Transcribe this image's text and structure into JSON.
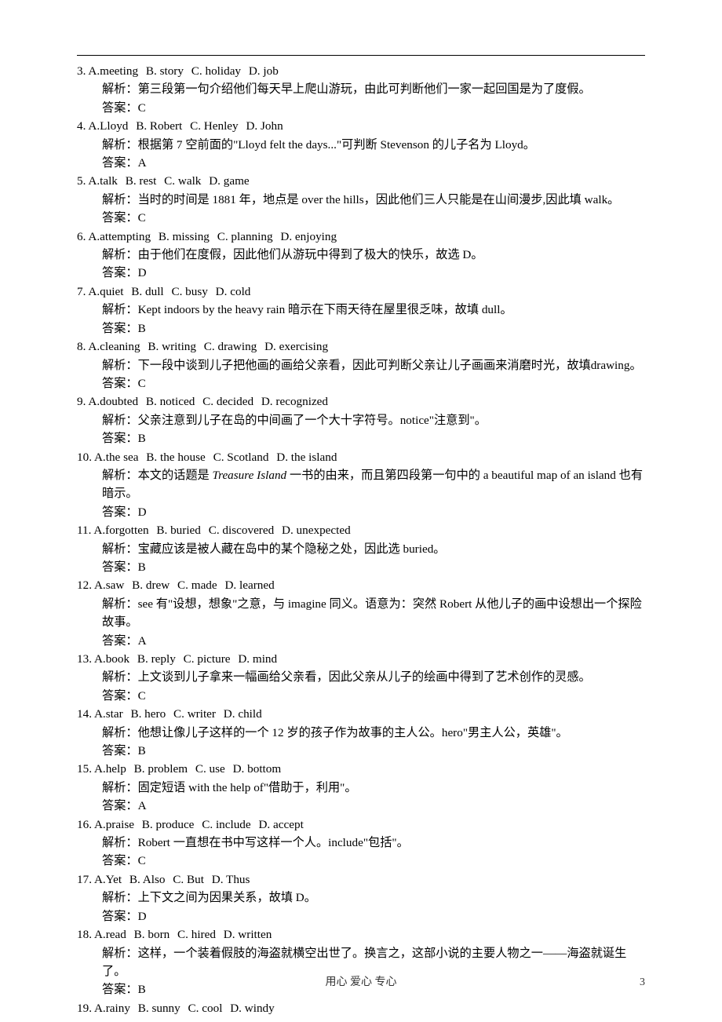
{
  "items": [
    {
      "num": "3.",
      "opts": [
        "A.meeting",
        "B. story",
        "C. holiday",
        "D. job"
      ],
      "expl": "解析：第三段第一句介绍他们每天早上爬山游玩，由此可判断他们一家一起回国是为了度假。",
      "ans": "答案：C"
    },
    {
      "num": "4.",
      "opts": [
        "A.Lloyd",
        "B. Robert",
        "C. Henley",
        "D. John"
      ],
      "expl": "解析：根据第 7 空前面的\"Lloyd felt the days...\"可判断 Stevenson 的儿子名为 Lloyd。",
      "ans": "答案：A"
    },
    {
      "num": "5.",
      "opts": [
        "A.talk",
        "B. rest",
        "C. walk",
        "D. game"
      ],
      "expl": "解析：当时的时间是 1881 年，地点是 over the hills，因此他们三人只能是在山间漫步,因此填 walk。",
      "ans": "答案：C"
    },
    {
      "num": "6.",
      "opts": [
        "A.attempting",
        "B. missing",
        "C. planning",
        "D. enjoying"
      ],
      "expl": "解析：由于他们在度假，因此他们从游玩中得到了极大的快乐，故选 D。",
      "ans": "答案：D"
    },
    {
      "num": "7.",
      "opts": [
        "A.quiet",
        "B. dull",
        "C. busy",
        "D. cold"
      ],
      "expl": "解析：Kept indoors by the heavy rain 暗示在下雨天待在屋里很乏味，故填 dull。",
      "ans": "答案：B"
    },
    {
      "num": "8.",
      "opts": [
        "A.cleaning",
        "B. writing",
        "C. drawing",
        "D. exercising"
      ],
      "expl": "解析：下一段中谈到儿子把他画的画给父亲看，因此可判断父亲让儿子画画来消磨时光，故填drawing。",
      "ans": "答案：C"
    },
    {
      "num": "9.",
      "opts": [
        "A.doubted",
        "B. noticed",
        "C. decided",
        "D. recognized"
      ],
      "expl": "解析：父亲注意到儿子在岛的中间画了一个大十字符号。notice\"注意到\"。",
      "ans": "答案：B"
    },
    {
      "num": "10.",
      "opts": [
        "A.the sea",
        "B. the house",
        "C. Scotland",
        "D. the island"
      ],
      "expl_pre": "解析：本文的话题是 ",
      "expl_italic": "Treasure Island",
      "expl_post": " 一书的由来，而且第四段第一句中的 a beautiful map of an island 也有暗示。",
      "ans": "答案：D"
    },
    {
      "num": "11.",
      "opts": [
        "A.forgotten",
        "B. buried",
        "C. discovered",
        "D. unexpected"
      ],
      "expl": "解析：宝藏应该是被人藏在岛中的某个隐秘之处，因此选 buried。",
      "ans": "答案：B"
    },
    {
      "num": "12.",
      "opts": [
        "A.saw",
        "B. drew",
        "C. made",
        "D. learned"
      ],
      "expl": "解析：see 有\"设想，想象\"之意，与 imagine 同义。语意为：突然 Robert 从他儿子的画中设想出一个探险故事。",
      "ans": "答案：A"
    },
    {
      "num": "13.",
      "opts": [
        "A.book",
        "B. reply",
        "C. picture",
        "D. mind"
      ],
      "expl": "解析：上文谈到儿子拿来一幅画给父亲看，因此父亲从儿子的绘画中得到了艺术创作的灵感。",
      "ans": "答案：C"
    },
    {
      "num": "14.",
      "opts": [
        "A.star",
        "B. hero",
        "C. writer",
        "D. child"
      ],
      "expl": "解析：他想让像儿子这样的一个 12 岁的孩子作为故事的主人公。hero\"男主人公，英雄\"。",
      "ans": "答案：B"
    },
    {
      "num": "15.",
      "opts": [
        "A.help",
        "B. problem",
        "C. use",
        "D. bottom"
      ],
      "expl": "解析：固定短语 with the help of\"借助于，利用\"。",
      "ans": "答案：A"
    },
    {
      "num": "16.",
      "opts": [
        "A.praise",
        "B. produce",
        "C. include",
        "D. accept"
      ],
      "expl": "解析：Robert 一直想在书中写这样一个人。include\"包括\"。",
      "ans": "答案：C"
    },
    {
      "num": "17.",
      "opts": [
        "A.Yet",
        "B. Also",
        "C. But",
        "D. Thus"
      ],
      "expl": "解析：上下文之间为因果关系，故填 D。",
      "ans": "答案：D"
    },
    {
      "num": "18.",
      "opts": [
        "A.read",
        "B. born",
        "C. hired",
        "D. written"
      ],
      "expl": "解析：这样，一个装着假肢的海盗就横空出世了。换言之，这部小说的主要人物之一——海盗就诞生了。",
      "ans": "答案：B"
    },
    {
      "num": "19.",
      "opts": [
        "A.rainy",
        "B. sunny",
        "C. cool",
        "D. windy"
      ]
    }
  ],
  "footer": "用心 爱心 专心",
  "pageNum": "3"
}
